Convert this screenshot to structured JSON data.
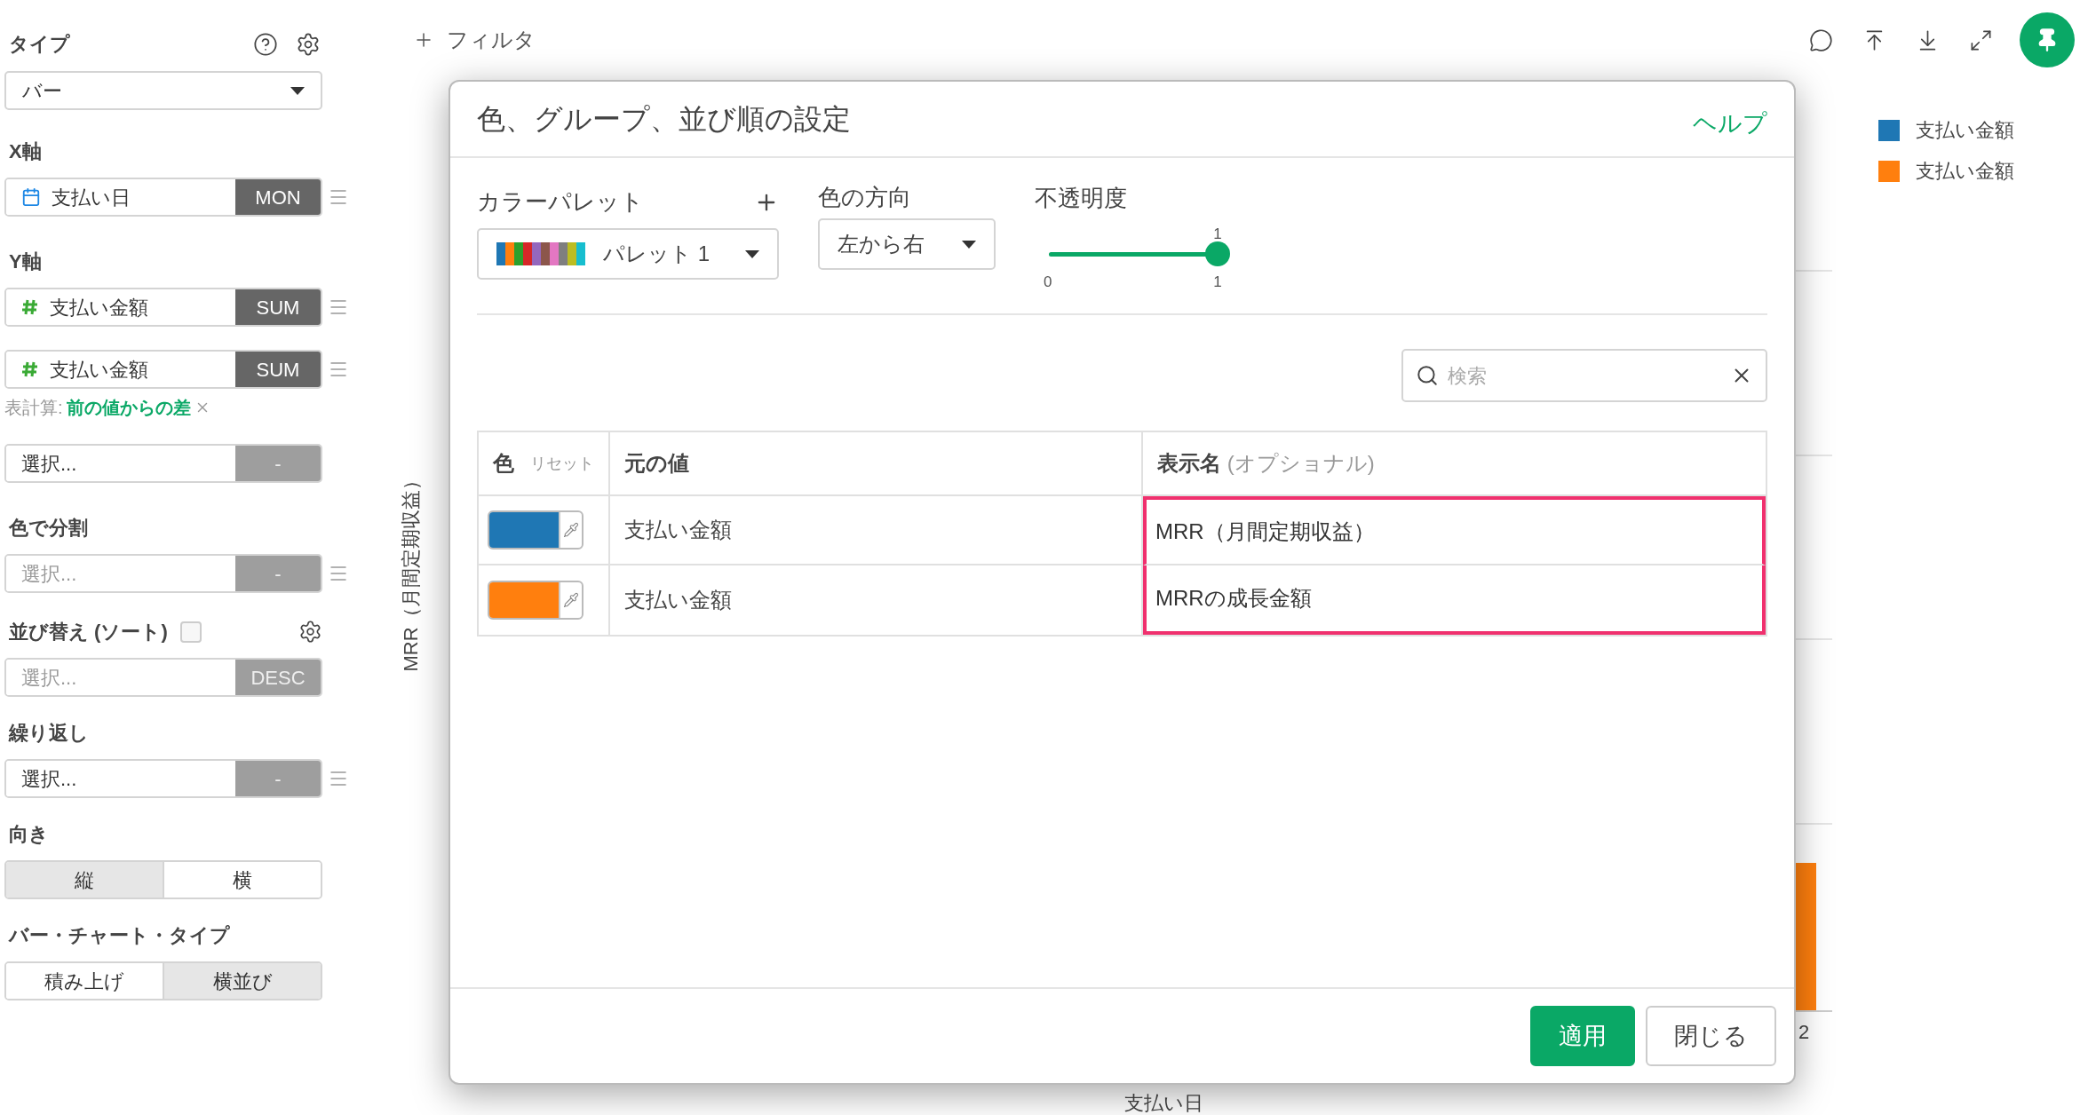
{
  "sidebar": {
    "type": {
      "label": "タイプ",
      "value": "バー"
    },
    "x_axis": {
      "label": "X軸",
      "fields": [
        {
          "kind": "date",
          "value": "支払い日",
          "aggregate": "MON",
          "disabled": false,
          "handle": true
        }
      ]
    },
    "y_axis": {
      "label": "Y軸",
      "fields": [
        {
          "kind": "number",
          "value": "支払い金額",
          "aggregate": "SUM",
          "disabled": false,
          "handle": true
        },
        {
          "kind": "number",
          "value": "支払い金額",
          "aggregate": "SUM",
          "disabled": false,
          "handle": true,
          "calc_label": "表計算:",
          "calc_value": "前の値からの差"
        },
        {
          "value": "選択...",
          "aggregate": "-",
          "disabled": true,
          "handle": false
        }
      ]
    },
    "color_split": {
      "label": "色で分割",
      "fields": [
        {
          "placeholder": "選択...",
          "aggregate": "-",
          "disabled": true,
          "handle": true
        }
      ]
    },
    "sort": {
      "label": "並び替え (ソート)",
      "checked": false,
      "fields": [
        {
          "placeholder": "選択...",
          "aggregate": "DESC",
          "disabled": true,
          "handle": false
        }
      ]
    },
    "repeat": {
      "label": "繰り返し",
      "fields": [
        {
          "value": "選択...",
          "aggregate": "-",
          "disabled": true,
          "handle": true
        }
      ]
    },
    "orientation": {
      "label": "向き",
      "options": [
        {
          "label": "縦",
          "selected": true
        },
        {
          "label": "横",
          "selected": false
        }
      ]
    },
    "bar_type": {
      "label": "バー・チャート・タイプ",
      "options": [
        {
          "label": "積み上げ",
          "selected": false
        },
        {
          "label": "横並び",
          "selected": true
        }
      ]
    }
  },
  "toolbar": {
    "filter": "フィルタ"
  },
  "chart": {
    "y_label": "MRR（月間定期収益）",
    "x_label": "支払い日",
    "x_tick": "2",
    "legend": [
      {
        "label": "支払い金額",
        "color": "#1f77b4"
      },
      {
        "label": "支払い金額",
        "color": "#ff7f0e"
      }
    ]
  },
  "dialog": {
    "title": "色、グループ、並び順の設定",
    "help": "ヘルプ",
    "palette": {
      "label": "カラーパレット",
      "value": "パレット 1"
    },
    "direction": {
      "label": "色の方向",
      "value": "左から右"
    },
    "opacity": {
      "label": "不透明度",
      "level": 1,
      "value": "1",
      "min": "0",
      "max": "1"
    },
    "search": {
      "placeholder": "検索"
    },
    "table": {
      "columns": [
        {
          "label": "色",
          "extra": "リセット"
        },
        {
          "label": "元の値"
        },
        {
          "label": "表示名",
          "extra": "(オプショナル)"
        }
      ],
      "rows": [
        {
          "color": "#1f77b4",
          "original": "支払い金額",
          "display": "MRR（月間定期収益）",
          "highlighted": true
        },
        {
          "color": "#ff7f0e",
          "original": "支払い金額",
          "display": "MRRの成長金額",
          "highlighted": true
        }
      ]
    },
    "buttons": [
      {
        "label": "適用",
        "kind": "primary"
      },
      {
        "label": "閉じる",
        "kind": "secondary"
      }
    ]
  }
}
